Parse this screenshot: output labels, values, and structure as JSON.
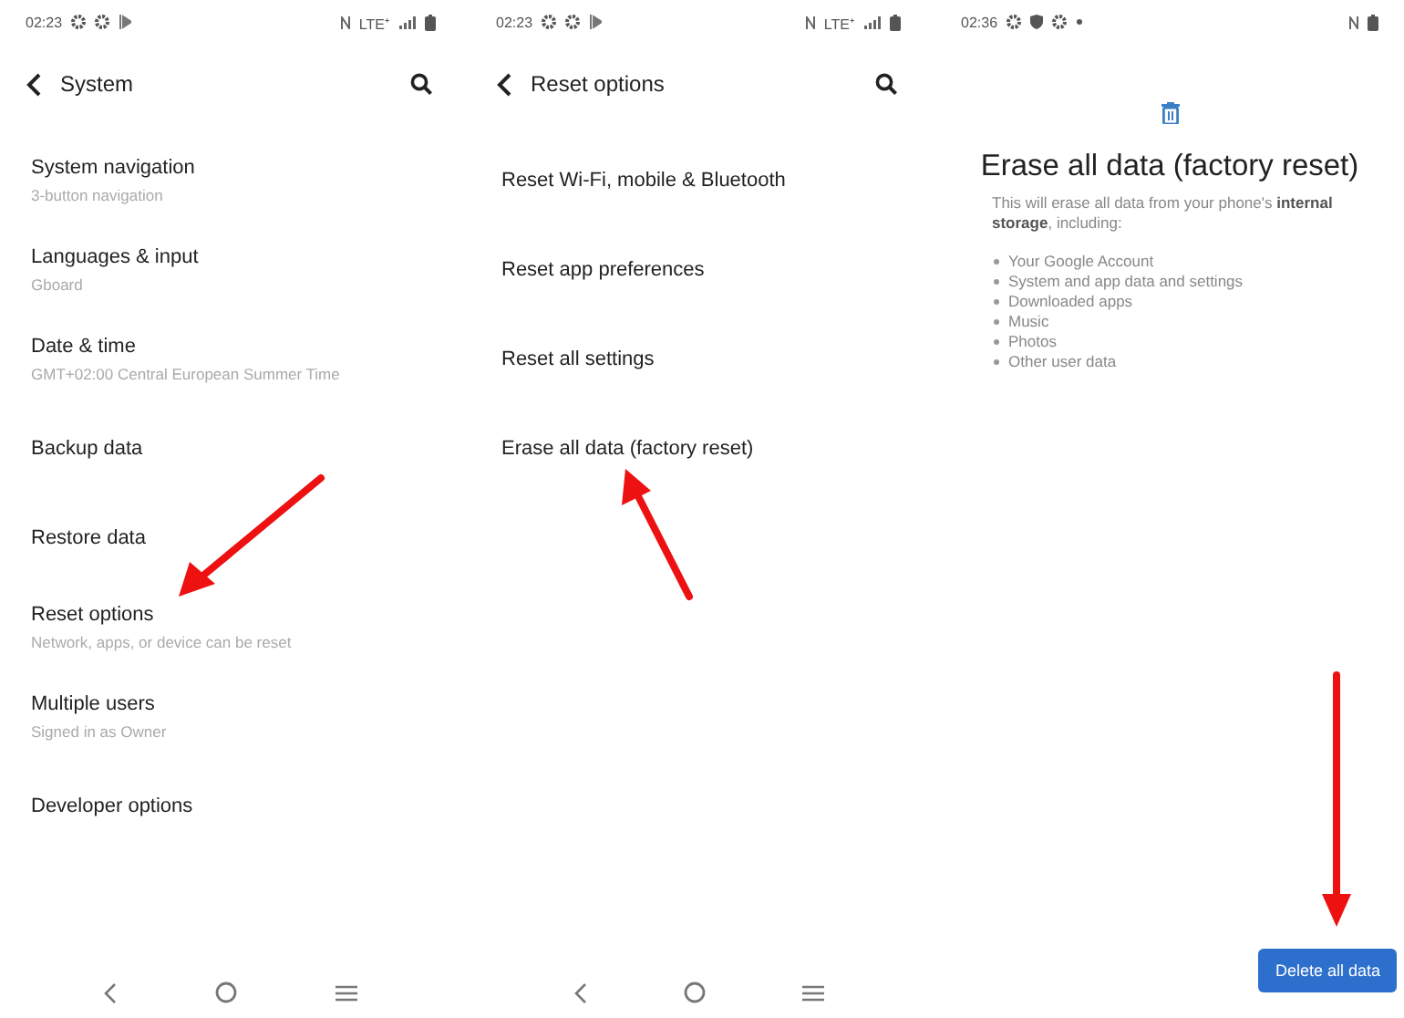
{
  "screens": [
    {
      "kind": "list",
      "status_bar": {
        "time": "02:23",
        "left_icons": [
          {
            "kind": "gear"
          },
          {
            "kind": "gear"
          },
          {
            "kind": "play"
          }
        ],
        "right_icons": [
          {
            "kind": "nfc"
          },
          {
            "kind": "text",
            "text": "LTE⁺"
          },
          {
            "kind": "signal"
          },
          {
            "kind": "battery"
          }
        ]
      },
      "header": {
        "title": "System"
      },
      "items": [
        {
          "title": "System navigation",
          "subtitle": "3-button navigation"
        },
        {
          "title": "Languages & input",
          "subtitle": "Gboard"
        },
        {
          "title": "Date & time",
          "subtitle": "GMT+02:00 Central European Summer Time"
        },
        {
          "title": "Backup data"
        },
        {
          "title": "Restore data"
        },
        {
          "title": "Reset options",
          "subtitle": "Network, apps, or device can be reset"
        },
        {
          "title": "Multiple users",
          "subtitle": "Signed in as Owner"
        },
        {
          "title": "Developer options"
        }
      ]
    },
    {
      "kind": "list",
      "status_bar": {
        "time": "02:23",
        "left_icons": [
          {
            "kind": "gear"
          },
          {
            "kind": "gear"
          },
          {
            "kind": "play"
          }
        ],
        "right_icons": [
          {
            "kind": "nfc"
          },
          {
            "kind": "text",
            "text": "LTE⁺"
          },
          {
            "kind": "signal"
          },
          {
            "kind": "battery"
          }
        ]
      },
      "header": {
        "title": "Reset options"
      },
      "items": [
        {
          "title": "Reset Wi-Fi, mobile & Bluetooth"
        },
        {
          "title": "Reset app preferences"
        },
        {
          "title": "Reset all settings"
        },
        {
          "title": "Erase all data (factory reset)"
        }
      ]
    },
    {
      "kind": "confirm",
      "status_bar": {
        "time": "02:36",
        "left_icons": [
          {
            "kind": "gear"
          },
          {
            "kind": "shield"
          },
          {
            "kind": "gear"
          },
          {
            "kind": "dot"
          }
        ],
        "right_icons": [
          {
            "kind": "nfc"
          },
          {
            "kind": "battery"
          }
        ]
      },
      "title": "Erase all data (factory reset)",
      "description": "This will erase all data from your phone's **internal storage**, including:",
      "bullets": [
        "Your Google Account",
        "System and app data and settings",
        "Downloaded apps",
        "Music",
        "Photos",
        "Other user data"
      ],
      "button": "Delete all data"
    }
  ]
}
